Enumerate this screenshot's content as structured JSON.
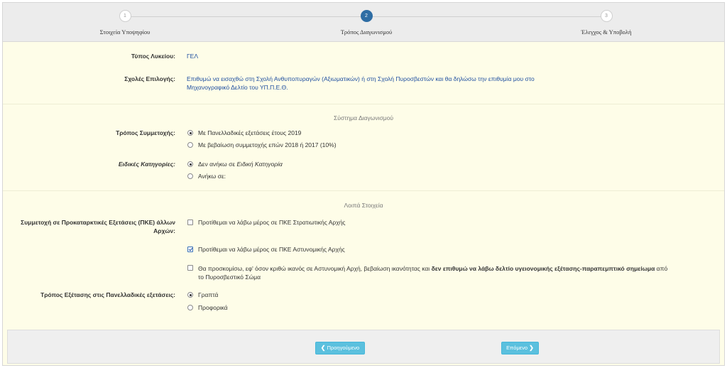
{
  "stepper": {
    "steps": [
      {
        "number": "1",
        "label": "Στοιχεία Υποψηφίου",
        "active": false
      },
      {
        "number": "2",
        "label": "Τρόπος Διαγωνισμού",
        "active": true
      },
      {
        "number": "3",
        "label": "Έλεγχος & Υποβολή",
        "active": false
      }
    ]
  },
  "lyceum": {
    "label": "Τύπος Λυκείου:",
    "value": "ΓΕΛ"
  },
  "schools": {
    "label": "Σχολές Επιλογής:",
    "value_line1": "Επιθυμώ να εισαχθώ στη Σχολή Ανθυποπυραγών (Αξιωματικών) ή στη Σχολή Πυροσβεστών και θα δηλώσω την επιθυμία μου στο",
    "value_line2": "Μηχανογραφικό Δελτίο του ΥΠ.Π.Ε.Θ."
  },
  "exam_system": {
    "title": "Σύστημα Διαγωνισμού",
    "participation_label": "Τρόπος Συμμετοχής:",
    "participation_options": [
      {
        "label": "Με Πανελλαδικές εξετάσεις έτους 2019",
        "selected": true
      },
      {
        "label": "Με βεβαίωση συμμετοχής επών 2018 ή 2017 (10%)",
        "selected": false
      }
    ],
    "categories_label": "Ειδικές Κατηγορίες:",
    "categories_options": [
      {
        "label_prefix": "Δεν ανήκω σε ",
        "label_em": "Ειδική Κατηγορία",
        "selected": true
      },
      {
        "label": "Ανήκω σε:",
        "selected": false
      }
    ]
  },
  "other": {
    "title": "Λοιπά Στοιχεία",
    "pke_label_line1": "Συμμετοχή σε Προκαταρκτικές Εξετάσεις (ΠΚΕ) άλλων",
    "pke_label_line2": "Αρχών:",
    "pke_options": [
      {
        "label": "Προτίθεμαι να λάβω μέρος σε ΠΚΕ Στρατιωτικής Αρχής",
        "checked": false
      },
      {
        "label": "Προτίθεμαι να λάβω μέρος σε ΠΚΕ Αστυνομικής Αρχής",
        "checked": true
      }
    ],
    "health_option": {
      "checked": false,
      "text_start": "Θα προσκομίσω, εφ' όσον κριθώ ικανός σε Αστυνομική Αρχή, βεβαίωση ικανότητας και ",
      "text_bold": "δεν επιθυμώ να λάβω δελτίο υγειονομικής εξέτασης-παραπεμπτικό σημείωμα",
      "text_end": " από",
      "text_line2": "το Πυροσβεστικό Σώμα"
    },
    "exam_mode_label": "Τρόπος Εξέτασης στις Πανελλαδικές εξετάσεις:",
    "exam_mode_options": [
      {
        "label": "Γραπτά",
        "selected": true
      },
      {
        "label": "Προφορικά",
        "selected": false
      }
    ]
  },
  "footer": {
    "prev_label": "Προηγούμενο",
    "next_label": "Επόμενο",
    "prev_icon": "chevron-left-icon",
    "next_icon": "chevron-right-icon"
  },
  "colors": {
    "page_bg": "#fefde8",
    "accent": "#2e6da4",
    "button": "#5bc0de",
    "value_text": "#1f4fa0"
  }
}
